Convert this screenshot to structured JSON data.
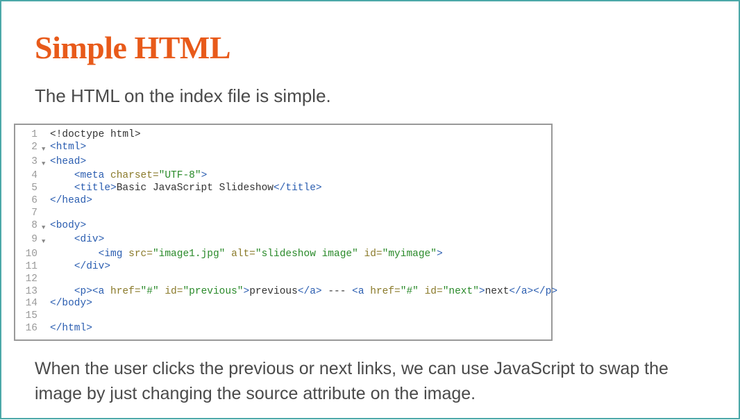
{
  "slide": {
    "title": "Simple HTML",
    "intro": "The HTML on the index file is simple.",
    "footer": "When the user clicks the previous or next links, we can use JavaScript to swap the image by just changing the source attribute on the image."
  },
  "code": {
    "lines": [
      {
        "n": "1",
        "fold": "",
        "tokens": [
          [
            "txt",
            "<!doctype html>"
          ]
        ]
      },
      {
        "n": "2",
        "fold": "▼",
        "tokens": [
          [
            "tag",
            "<html>"
          ]
        ]
      },
      {
        "n": "3",
        "fold": "▼",
        "tokens": [
          [
            "tag",
            "<head>"
          ]
        ]
      },
      {
        "n": "4",
        "fold": "",
        "tokens": [
          [
            "txt",
            "    "
          ],
          [
            "tag",
            "<meta "
          ],
          [
            "attr",
            "charset="
          ],
          [
            "val",
            "\"UTF-8\""
          ],
          [
            "tag",
            ">"
          ]
        ]
      },
      {
        "n": "5",
        "fold": "",
        "tokens": [
          [
            "txt",
            "    "
          ],
          [
            "tag",
            "<title>"
          ],
          [
            "txt",
            "Basic JavaScript Slideshow"
          ],
          [
            "tag",
            "</title>"
          ]
        ]
      },
      {
        "n": "6",
        "fold": "",
        "tokens": [
          [
            "tag",
            "</head>"
          ]
        ]
      },
      {
        "n": "7",
        "fold": "",
        "tokens": [
          [
            "txt",
            ""
          ]
        ]
      },
      {
        "n": "8",
        "fold": "▼",
        "tokens": [
          [
            "tag",
            "<body>"
          ]
        ]
      },
      {
        "n": "9",
        "fold": "▼",
        "tokens": [
          [
            "txt",
            "    "
          ],
          [
            "tag",
            "<div>"
          ]
        ]
      },
      {
        "n": "10",
        "fold": "",
        "tokens": [
          [
            "txt",
            "        "
          ],
          [
            "tag",
            "<img "
          ],
          [
            "attr",
            "src="
          ],
          [
            "val",
            "\"image1.jpg\""
          ],
          [
            "txt",
            " "
          ],
          [
            "attr",
            "alt="
          ],
          [
            "val",
            "\"slideshow image\""
          ],
          [
            "txt",
            " "
          ],
          [
            "attr",
            "id="
          ],
          [
            "val",
            "\"myimage\""
          ],
          [
            "tag",
            ">"
          ]
        ]
      },
      {
        "n": "11",
        "fold": "",
        "tokens": [
          [
            "txt",
            "    "
          ],
          [
            "tag",
            "</div>"
          ]
        ]
      },
      {
        "n": "12",
        "fold": "",
        "tokens": [
          [
            "txt",
            ""
          ]
        ]
      },
      {
        "n": "13",
        "fold": "",
        "tokens": [
          [
            "txt",
            "    "
          ],
          [
            "tag",
            "<p><a "
          ],
          [
            "attr",
            "href="
          ],
          [
            "val",
            "\"#\""
          ],
          [
            "txt",
            " "
          ],
          [
            "attr",
            "id="
          ],
          [
            "val",
            "\"previous\""
          ],
          [
            "tag",
            ">"
          ],
          [
            "txt",
            "previous"
          ],
          [
            "tag",
            "</a>"
          ],
          [
            "txt",
            " --- "
          ],
          [
            "tag",
            "<a "
          ],
          [
            "attr",
            "href="
          ],
          [
            "val",
            "\"#\""
          ],
          [
            "txt",
            " "
          ],
          [
            "attr",
            "id="
          ],
          [
            "val",
            "\"next\""
          ],
          [
            "tag",
            ">"
          ],
          [
            "txt",
            "next"
          ],
          [
            "tag",
            "</a></p>"
          ]
        ]
      },
      {
        "n": "14",
        "fold": "",
        "tokens": [
          [
            "tag",
            "</body>"
          ]
        ]
      },
      {
        "n": "15",
        "fold": "",
        "tokens": [
          [
            "txt",
            ""
          ]
        ]
      },
      {
        "n": "16",
        "fold": "",
        "tokens": [
          [
            "tag",
            "</html>"
          ]
        ]
      }
    ]
  }
}
